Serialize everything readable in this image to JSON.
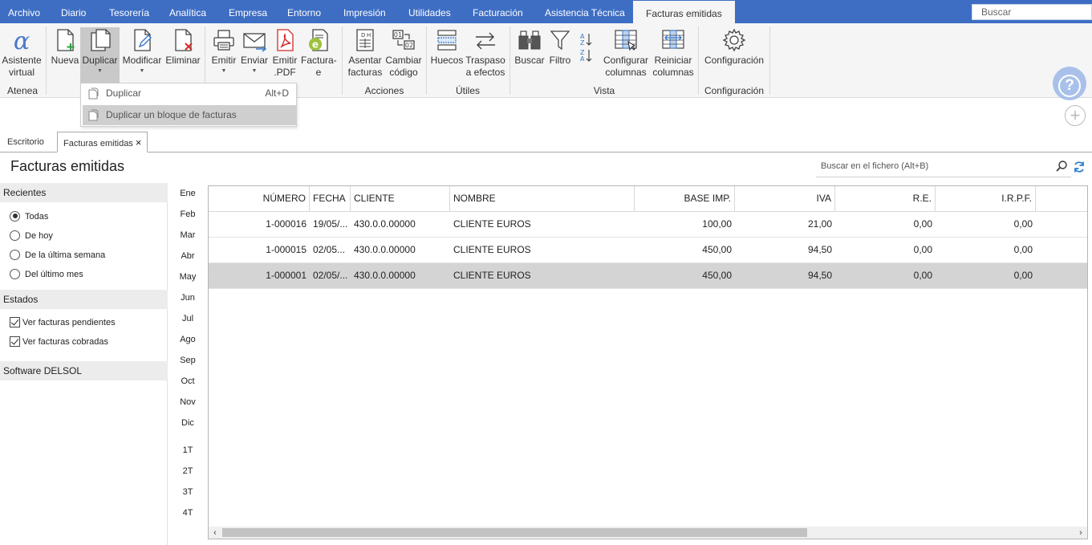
{
  "menu": {
    "items": [
      "Archivo",
      "Diario",
      "Tesorería",
      "Analítica",
      "Empresa",
      "Entorno",
      "Impresión",
      "Utilidades",
      "Facturación",
      "Asistencia Técnica"
    ],
    "active": "Facturas emitidas",
    "search_placeholder": "Buscar"
  },
  "ribbon": {
    "atenea": {
      "assistant_line1": "Asistente",
      "assistant_line2": "virtual",
      "group": "Atenea"
    },
    "main": {
      "new": "Nueva",
      "duplicate": "Duplicar",
      "modify": "Modificar",
      "delete": "Eliminar"
    },
    "output": {
      "issue": "Emitir",
      "send": "Enviar",
      "pdf_line1": "Emitir",
      "pdf_line2": ".PDF",
      "einvoice_line1": "Factura-",
      "einvoice_line2": "e"
    },
    "actions": {
      "post_line1": "Asentar",
      "post_line2": "facturas",
      "change_line1": "Cambiar",
      "change_line2": "código",
      "group": "Acciones"
    },
    "tools": {
      "gaps": "Huecos",
      "transfer_line1": "Traspaso",
      "transfer_line2": "a efectos",
      "group": "Útiles"
    },
    "view": {
      "search": "Buscar",
      "filter": "Filtro",
      "config_cols_line1": "Configurar",
      "config_cols_line2": "columnas",
      "reset_cols_line1": "Reiniciar",
      "reset_cols_line2": "columnas",
      "group": "Vista"
    },
    "config": {
      "label": "Configuración",
      "group": "Configuración"
    }
  },
  "dropdown": {
    "items": [
      {
        "label": "Duplicar",
        "shortcut": "Alt+D"
      },
      {
        "label": "Duplicar un bloque de facturas",
        "shortcut": ""
      }
    ]
  },
  "tabs": {
    "desk": "Escritorio",
    "invoices": "Facturas emitidas",
    "close": "×"
  },
  "page": {
    "title": "Facturas emitidas",
    "file_search_placeholder": "Buscar en el fichero (Alt+B)"
  },
  "sidebar": {
    "recent_header": "Recientes",
    "recent_options": [
      "Todas",
      "De hoy",
      "De la última semana",
      "Del último mes"
    ],
    "recent_selected": "Todas",
    "states_header": "Estados",
    "states_options": [
      "Ver facturas pendientes",
      "Ver facturas cobradas"
    ],
    "footer": "Software DELSOL"
  },
  "months": [
    "Ene",
    "Feb",
    "Mar",
    "Abr",
    "May",
    "Jun",
    "Jul",
    "Ago",
    "Sep",
    "Oct",
    "Nov",
    "Dic"
  ],
  "quarters": [
    "1T",
    "2T",
    "3T",
    "4T"
  ],
  "selected_month": "May",
  "table": {
    "columns": [
      "NÚMERO",
      "FECHA",
      "CLIENTE",
      "NOMBRE",
      "BASE IMP.",
      "IVA",
      "R.E.",
      "I.R.P.F."
    ],
    "rows": [
      [
        "1-000016",
        "19/05/...",
        "430.0.0.00000",
        "CLIENTE EUROS",
        "100,00",
        "21,00",
        "0,00",
        "0,00"
      ],
      [
        "1-000015",
        "02/05...",
        "430.0.0.00000",
        "CLIENTE EUROS",
        "450,00",
        "94,50",
        "0,00",
        "0,00"
      ],
      [
        "1-000001",
        "02/05/...",
        "430.0.0.00000",
        "CLIENTE EUROS",
        "450,00",
        "94,50",
        "0,00",
        "0,00"
      ]
    ],
    "selected_row": 2
  },
  "colors": {
    "menubar": "#3e6ec4",
    "accent_green": "#2e9e3e",
    "accent_red": "#d42a2a",
    "accent_blue": "#3b78c9",
    "help": "#a9c1ea"
  }
}
